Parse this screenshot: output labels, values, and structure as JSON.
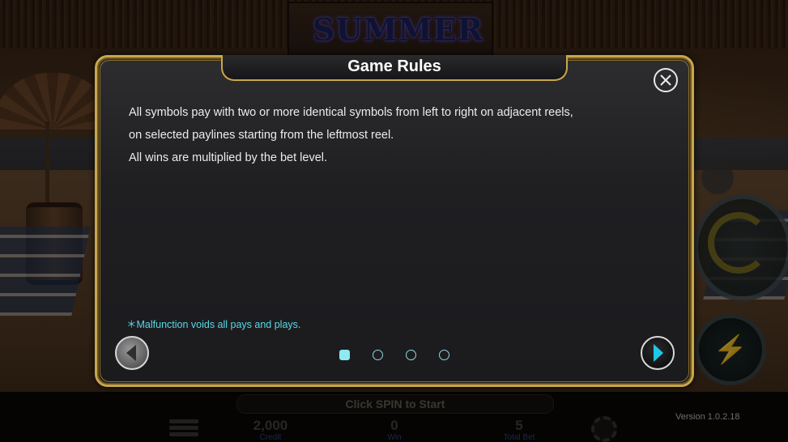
{
  "background": {
    "game_title": "SUMMER"
  },
  "bottom_bar": {
    "status": "Click SPIN to Start",
    "credit_value": "2,000",
    "credit_label": "Credit",
    "win_value": "0",
    "win_label": "Win",
    "total_bet_value": "5",
    "total_bet_label": "Total Bet",
    "version": "Version 1.0.2.18"
  },
  "modal": {
    "title": "Game Rules",
    "rules": [
      "All symbols pay with two or more identical symbols from left to right on adjacent reels,",
      "on selected paylines starting from the leftmost reel.",
      "All wins are multiplied by the bet level."
    ],
    "note": "＊Malfunction voids all pays and plays.",
    "page_count": 4,
    "current_page": 1
  },
  "icons": {
    "close": "close-icon",
    "prev": "arrow-left-icon",
    "next": "arrow-right-icon",
    "menu": "menu-icon",
    "spin": "spin-icon",
    "turbo": "lightning-icon",
    "chips": "chips-icon"
  },
  "colors": {
    "frame_gold": "#c9a64c",
    "note_cyan": "#59d8e6",
    "next_arrow": "#1fc8e8",
    "dot_active": "#8fe8f2"
  }
}
